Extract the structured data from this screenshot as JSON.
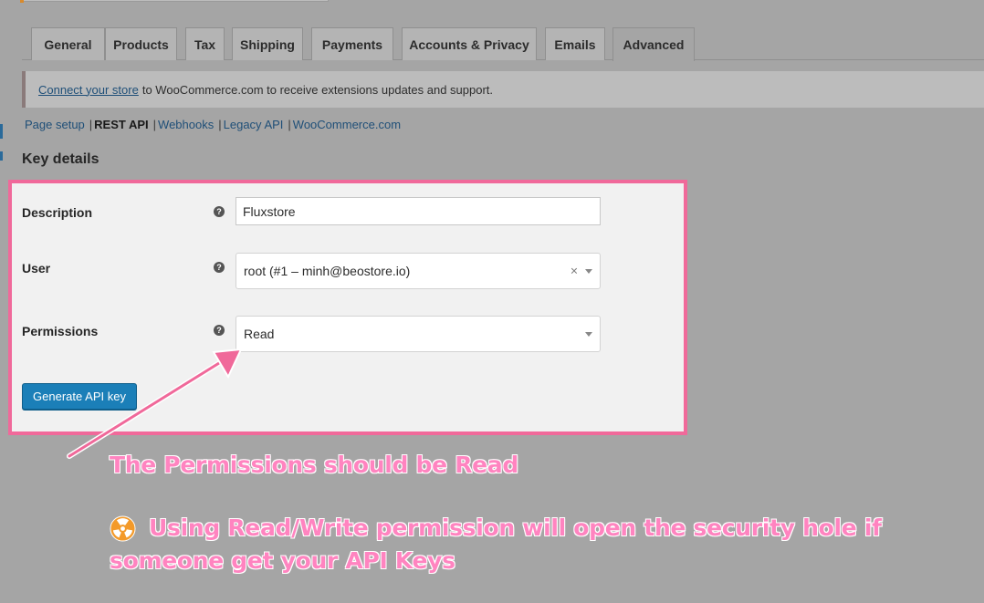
{
  "tabs": [
    {
      "label": "General"
    },
    {
      "label": "Products"
    },
    {
      "label": "Tax"
    },
    {
      "label": "Shipping"
    },
    {
      "label": "Payments"
    },
    {
      "label": "Accounts & Privacy"
    },
    {
      "label": "Emails"
    },
    {
      "label": "Advanced",
      "active": true
    }
  ],
  "notice": {
    "link": "Connect your store",
    "text": "to WooCommerce.com to receive extensions updates and support."
  },
  "subnav": {
    "items": [
      "Page setup",
      "REST API",
      "Webhooks",
      "Legacy API",
      "WooCommerce.com"
    ],
    "current": "REST API",
    "separator": "|"
  },
  "section_title": "Key details",
  "form": {
    "description": {
      "label": "Description",
      "value": "Fluxstore"
    },
    "user": {
      "label": "User",
      "value": "root (#1 – minh@beostore.io)",
      "clear": "×"
    },
    "permissions": {
      "label": "Permissions",
      "value": "Read"
    },
    "help_glyph": "?",
    "submit_label": "Generate API key"
  },
  "annotation": {
    "line1": "The Permissions should be Read",
    "line2": "Using Read/Write permission will open the security hole if",
    "line3": "someone get your API Keys",
    "icon": "radioactive-icon",
    "color": "#ff84c0",
    "border_color": "#f0699a"
  }
}
